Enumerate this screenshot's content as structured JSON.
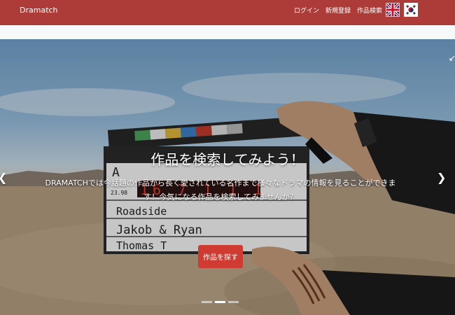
{
  "navbar": {
    "brand": "Dramatch",
    "links": [
      "ログイン",
      "新規登録",
      "作品検索"
    ],
    "flags": [
      "uk-flag-icon",
      "korea-flag-icon"
    ],
    "color": "#ad3b37"
  },
  "hero": {
    "title": "作品を検索してみよう！",
    "description": "DRAMATCHでは今話題の作品から長く愛されている名作まで様々なドラマの情報を見ることができます！今気になる作品を検索してみませんか？",
    "button_label": "作品を探す",
    "button_color": "#cf3a31",
    "slide_count": 3,
    "active_slide": 1,
    "clapboard": {
      "scene": "Roadside",
      "director": "Jakob & Ryan",
      "camera": "Thomas T",
      "timecode": "16 7 1 1 1",
      "roll": "A",
      "slate": "23.98"
    }
  }
}
